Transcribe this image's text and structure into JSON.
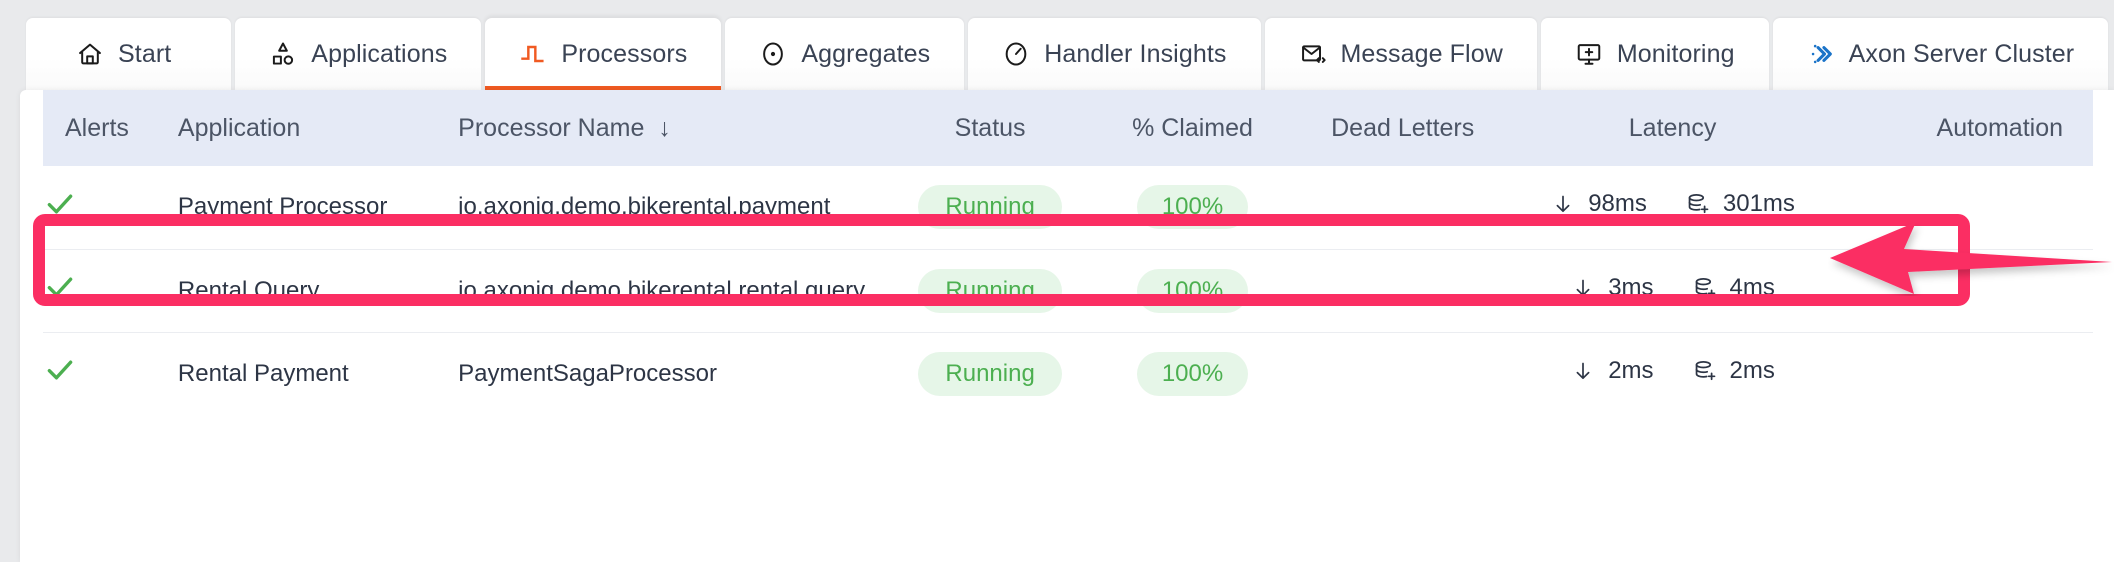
{
  "tabs": [
    {
      "label": "Start",
      "icon": "home-icon",
      "active": false
    },
    {
      "label": "Applications",
      "icon": "shapes-icon",
      "active": false
    },
    {
      "label": "Processors",
      "icon": "pulse-icon",
      "active": true
    },
    {
      "label": "Aggregates",
      "icon": "target-icon",
      "active": false
    },
    {
      "label": "Handler Insights",
      "icon": "gauge-icon",
      "active": false
    },
    {
      "label": "Message Flow",
      "icon": "envelope-code-icon",
      "active": false
    },
    {
      "label": "Monitoring",
      "icon": "monitor-icon",
      "active": false
    },
    {
      "label": "Axon Server Cluster",
      "icon": "chevrons-icon",
      "active": false
    }
  ],
  "table": {
    "columns": [
      {
        "key": "alerts",
        "label": "Alerts",
        "sorted": false
      },
      {
        "key": "app",
        "label": "Application",
        "sorted": false
      },
      {
        "key": "proc",
        "label": "Processor Name",
        "sorted": true,
        "sort_arrow": "↓"
      },
      {
        "key": "status",
        "label": "Status",
        "sorted": false
      },
      {
        "key": "claimed",
        "label": "% Claimed",
        "sorted": false
      },
      {
        "key": "dead",
        "label": "Dead Letters",
        "sorted": false
      },
      {
        "key": "latency",
        "label": "Latency",
        "sorted": false
      },
      {
        "key": "automation",
        "label": "Automation",
        "sorted": false
      }
    ],
    "rows": [
      {
        "alert_icon": "green-check-icon",
        "application": "Payment Processor",
        "processor_name": "io.axoniq.demo.bikerental.payment",
        "status": "Running",
        "claimed": "100%",
        "dead_letters": "",
        "latency_ingest": "98ms",
        "latency_commit": "301ms",
        "automation": "",
        "highlighted": true
      },
      {
        "alert_icon": "green-check-icon",
        "application": "Rental Query",
        "processor_name": "io.axoniq.demo.bikerental.rental.query",
        "status": "Running",
        "claimed": "100%",
        "dead_letters": "",
        "latency_ingest": "3ms",
        "latency_commit": "4ms",
        "automation": "",
        "highlighted": false
      },
      {
        "alert_icon": "green-check-icon",
        "application": "Rental Payment",
        "processor_name": "PaymentSagaProcessor",
        "status": "Running",
        "claimed": "100%",
        "dead_letters": "",
        "latency_ingest": "2ms",
        "latency_commit": "2ms",
        "automation": "",
        "highlighted": false
      }
    ],
    "latency_icons": {
      "ingest": "down-arrow-icon",
      "commit": "database-plus-icon"
    }
  },
  "annotation": {
    "highlight_color": "#fb2e63",
    "arrow_icon": "left-arrow-annotation",
    "target_row": "Payment Processor"
  },
  "colors": {
    "accent_orange": "#f05a22",
    "status_green": "#4caf50",
    "status_green_bg": "#e6f6e8",
    "header_blue": "#e5eaf6",
    "annotation_pink": "#fb2e63",
    "page_bg": "#e9eaec"
  }
}
